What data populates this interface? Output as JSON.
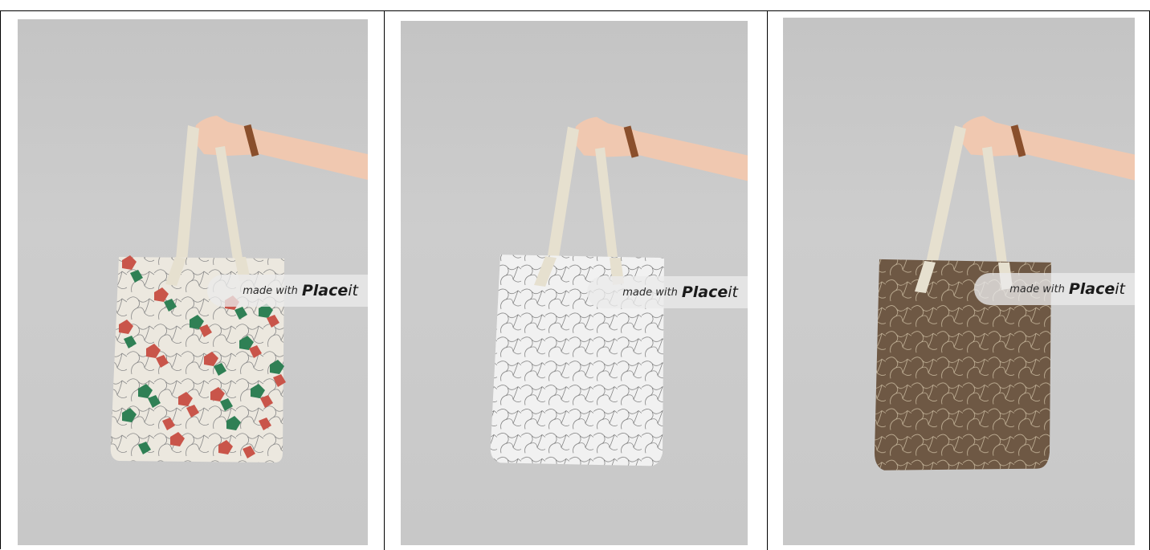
{
  "mockups": [
    {
      "pattern": "cream with red and green tile pattern",
      "bag_color": "#ece8df",
      "accent_red": "#c9554a",
      "accent_green": "#2f8055",
      "line_color": "#7a7a7a"
    },
    {
      "pattern": "white with gray tile outlines",
      "bag_color": "#f1f1f1",
      "line_color": "#8c8c8c"
    },
    {
      "pattern": "brown with light tile outlines",
      "bag_color": "#6e5844",
      "line_color": "#b8a58c"
    }
  ],
  "watermark": {
    "prefix": "made with",
    "brand_bold": "Place",
    "brand_suffix": "it"
  },
  "colors": {
    "background": "#c8c8c8",
    "strap": "#e6e0cf",
    "skin": "#f0c8b0",
    "bracelet": "#8a4f2c"
  }
}
